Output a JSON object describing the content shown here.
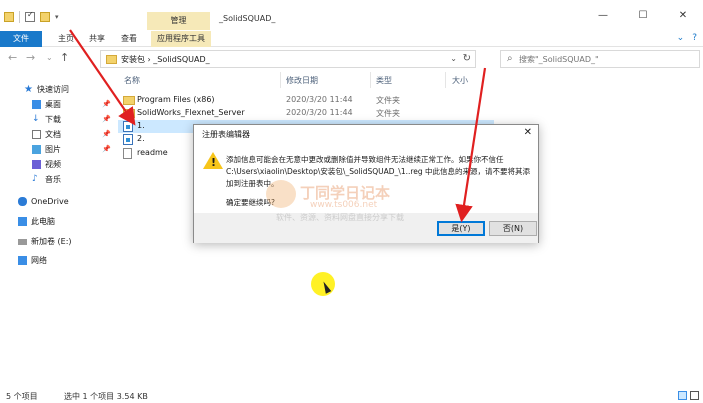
{
  "window": {
    "title": "_SolidSQUAD_",
    "context_tab": "管理",
    "buttons": [
      "—",
      "☐",
      "✕"
    ]
  },
  "ribbon": {
    "tabs": [
      "文件",
      "主页",
      "共享",
      "查看",
      "应用程序工具"
    ]
  },
  "address": {
    "crumbs": "安装包  ›  _SolidSQUAD_",
    "search_placeholder": "搜索\"_SolidSQUAD_\""
  },
  "sidebar": {
    "items": [
      {
        "label": "快速访问",
        "icon": "star-icon"
      },
      {
        "label": "桌面",
        "icon": "desktop-icon"
      },
      {
        "label": "下载",
        "icon": "download-icon"
      },
      {
        "label": "文档",
        "icon": "document-icon"
      },
      {
        "label": "图片",
        "icon": "picture-icon"
      },
      {
        "label": "视频",
        "icon": "video-icon"
      },
      {
        "label": "音乐",
        "icon": "music-icon"
      },
      {
        "label": "OneDrive",
        "icon": "cloud-icon"
      },
      {
        "label": "此电脑",
        "icon": "computer-icon"
      },
      {
        "label": "新加卷 (E:)",
        "icon": "drive-icon"
      },
      {
        "label": "网络",
        "icon": "network-icon"
      }
    ]
  },
  "columns": {
    "name": "名称",
    "date": "修改日期",
    "type": "类型",
    "size": "大小"
  },
  "files": [
    {
      "name": "Program Files (x86)",
      "date": "2020/3/20 11:44",
      "type": "文件夹",
      "icon": "folder-icon"
    },
    {
      "name": "SolidWorks_Flexnet_Server",
      "date": "2020/3/20 11:44",
      "type": "文件夹",
      "icon": "folder-icon"
    },
    {
      "name": "1.",
      "date": "",
      "type": "",
      "icon": "registry-file-icon"
    },
    {
      "name": "2.",
      "date": "",
      "type": "",
      "icon": "registry-file-icon"
    },
    {
      "name": "readme",
      "date": "",
      "type": "",
      "icon": "text-file-icon"
    }
  ],
  "status": {
    "count": "5 个项目",
    "selection": "选中 1 个项目  3.54 KB"
  },
  "dialog": {
    "title": "注册表编辑器",
    "close": "✕",
    "message_lines": [
      "添加信息可能会在无意中更改或删除值并导致组件无法继续正常工作。如果你不信任",
      "C:\\Users\\xiaolin\\Desktop\\安装包\\_SolidSQUAD_\\1..reg 中此信息的来源，请不要将其添",
      "加到注册表中。"
    ],
    "confirm": "确定要继续吗?",
    "yes": "是(Y)",
    "no": "否(N)"
  },
  "watermark": {
    "brand": "丁同学日记本",
    "url": "www.ts006.net",
    "tagline": "软件、资源、资料网盘直接分享下载"
  }
}
